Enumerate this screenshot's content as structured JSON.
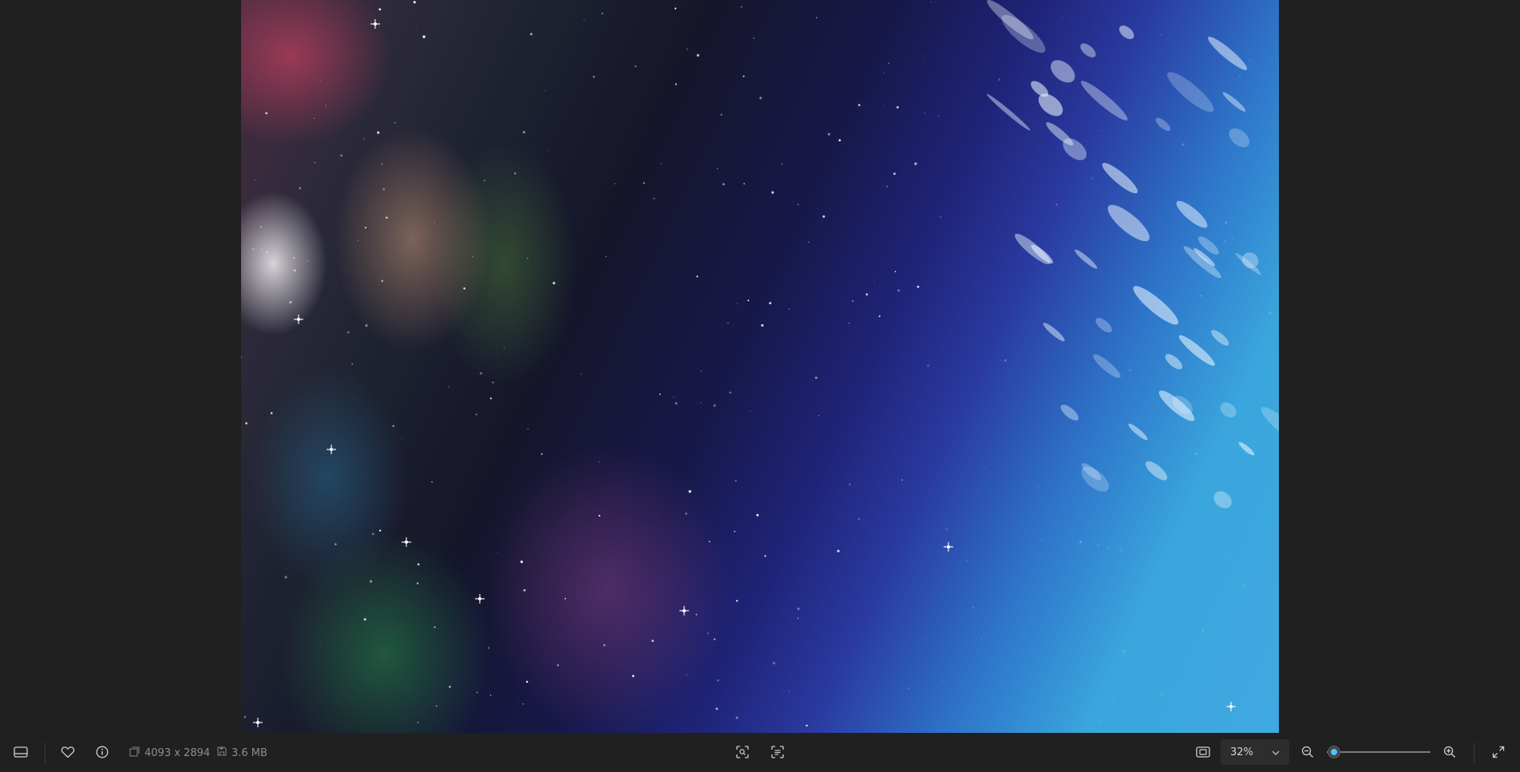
{
  "app": {
    "accent_color": "#4cc2ff",
    "background_color": "#202020"
  },
  "image": {
    "description_icon": "space-nebula-photo"
  },
  "toolbar": {
    "filmstrip_icon": "filmstrip-icon",
    "favorite_icon": "heart-icon",
    "info_icon": "info-icon",
    "dimensions": "4093 x 2894",
    "file_size": "3.6 MB",
    "dimensions_icon": "image-dimensions-icon",
    "file_size_icon": "save-disk-icon",
    "crop_icon": "visual-search-icon",
    "ocr_icon": "scan-text-icon",
    "fit_icon": "fit-to-window-icon",
    "zoom_level": "32%",
    "zoom_out_icon": "zoom-out-icon",
    "zoom_in_icon": "zoom-in-icon",
    "fullscreen_icon": "fullscreen-icon",
    "zoom_slider_fraction": 0.07
  }
}
